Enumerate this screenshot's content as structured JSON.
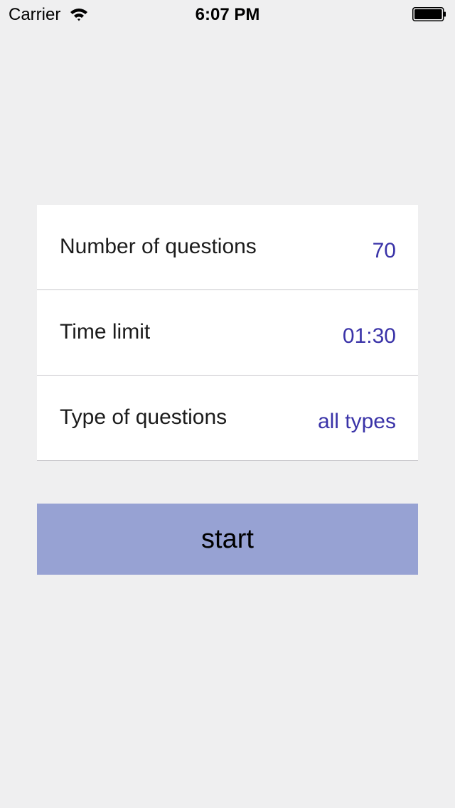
{
  "status_bar": {
    "carrier": "Carrier",
    "time": "6:07 PM",
    "wifi_icon": "wifi-icon",
    "battery_icon": "battery-icon"
  },
  "settings": {
    "rows": [
      {
        "label": "Number of questions",
        "value": "70"
      },
      {
        "label": "Time limit",
        "value": "01:30"
      },
      {
        "label": "Type of questions",
        "value": "all types"
      }
    ]
  },
  "start_button": {
    "label": "start"
  },
  "colors": {
    "background": "#efeff0",
    "card": "#ffffff",
    "value_text": "#3a33a8",
    "button": "#97a2d3",
    "divider": "#c8c7cc"
  }
}
